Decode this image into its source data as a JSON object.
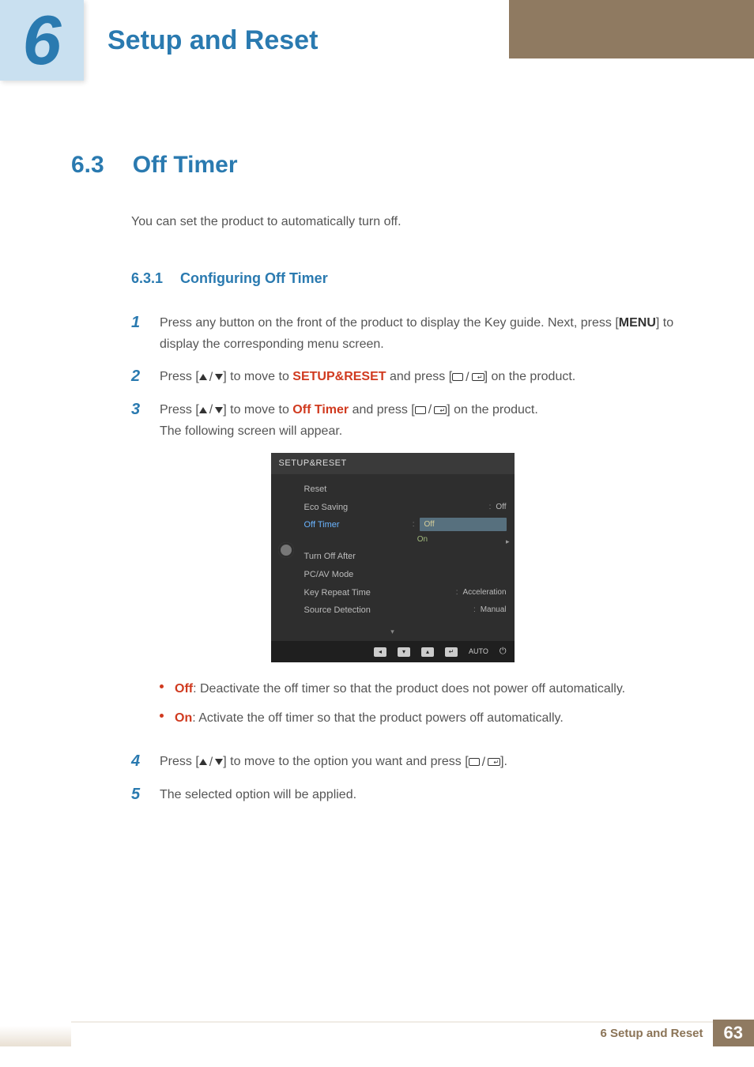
{
  "chapter": {
    "number": "6",
    "title": "Setup and Reset"
  },
  "section": {
    "number": "6.3",
    "title": "Off Timer"
  },
  "intro": "You can set the product to automatically turn off.",
  "subsection": {
    "number": "6.3.1",
    "title": "Configuring Off Timer"
  },
  "steps": {
    "s1a": "Press any button on the front of the product to display the Key guide. Next, press [",
    "s1menu": "MENU",
    "s1b": "] to display the corresponding menu screen.",
    "s2a": "Press [",
    "s2b": "] to move to ",
    "s2hl": "SETUP&RESET",
    "s2c": " and press [",
    "s2d": "] on the product.",
    "s3a": "Press [",
    "s3b": "] to move to ",
    "s3hl": "Off Timer",
    "s3c": " and press [",
    "s3d": "] on the product.",
    "s3e": "The following screen will appear.",
    "bOffLabel": "Off",
    "bOffText": ": Deactivate the off timer so that the product does not power off automatically.",
    "bOnLabel": "On",
    "bOnText": ": Activate the off timer so that the product powers off automatically.",
    "s4a": "Press [",
    "s4b": "] to move to the option you want and press [",
    "s4c": "].",
    "s5": "The selected option will be applied."
  },
  "osd": {
    "title": "SETUP&RESET",
    "rows": {
      "reset": "Reset",
      "eco": "Eco Saving",
      "ecoVal": "Off",
      "off": "Off Timer",
      "offSel": "Off",
      "offOpt": "On",
      "turnoff": "Turn Off After",
      "pcav": "PC/AV Mode",
      "krt": "Key Repeat Time",
      "krtVal": "Acceleration",
      "src": "Source Detection",
      "srcVal": "Manual"
    },
    "footer": {
      "auto": "AUTO"
    }
  },
  "footer": {
    "chapter": "6 Setup and Reset",
    "page": "63"
  }
}
